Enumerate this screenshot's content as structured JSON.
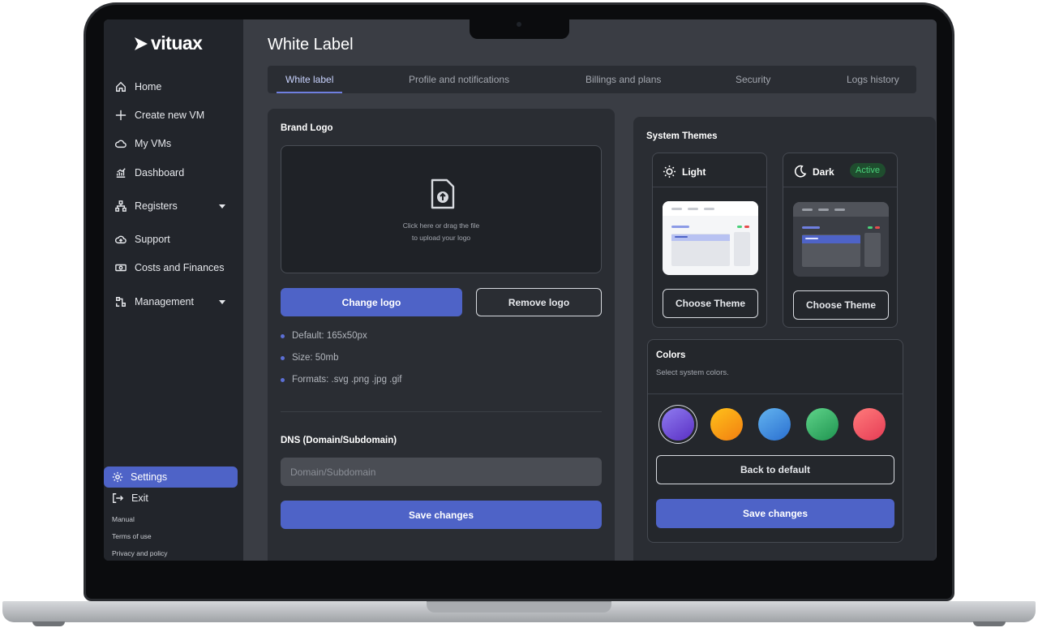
{
  "brand": {
    "name": "vituax"
  },
  "sidebar": {
    "items": [
      {
        "label": "Home",
        "icon": "home-icon"
      },
      {
        "label": "Create new VM",
        "icon": "plus-icon"
      },
      {
        "label": "My VMs",
        "icon": "cloud-icon"
      },
      {
        "label": "Dashboard",
        "icon": "chart-icon"
      },
      {
        "label": "Registers",
        "icon": "hierarchy-icon",
        "dropdown": true
      },
      {
        "label": "Support",
        "icon": "cloud-upload-icon"
      },
      {
        "label": "Costs and Finances",
        "icon": "money-icon"
      },
      {
        "label": "Management",
        "icon": "management-icon",
        "dropdown": true
      }
    ],
    "settings_label": "Settings",
    "exit_label": "Exit",
    "links": [
      "Manual",
      "Terms of use",
      "Privacy and policy"
    ]
  },
  "page": {
    "title": "White Label"
  },
  "tabs": [
    {
      "label": "White label",
      "active": true
    },
    {
      "label": "Profile and notifications",
      "active": false
    },
    {
      "label": "Billings and plans",
      "active": false
    },
    {
      "label": "Security",
      "active": false
    },
    {
      "label": "Logs history",
      "active": false
    }
  ],
  "brand_logo": {
    "title": "Brand Logo",
    "upload_line1": "Click here or drag the file",
    "upload_line2": "to upload your logo",
    "change_label": "Change logo",
    "remove_label": "Remove logo",
    "specs": [
      "Default: 165x50px",
      "Size: 50mb",
      "Formats: .svg .png .jpg .gif"
    ]
  },
  "dns": {
    "title": "DNS (Domain/Subdomain)",
    "placeholder": "Domain/Subdomain",
    "value": "",
    "save_label": "Save changes"
  },
  "themes": {
    "title": "System Themes",
    "light": {
      "label": "Light",
      "button": "Choose Theme"
    },
    "dark": {
      "label": "Dark",
      "badge": "Active",
      "button": "Choose Theme"
    }
  },
  "colors": {
    "title": "Colors",
    "subtitle": "Select system colors.",
    "swatches": [
      {
        "name": "purple",
        "from": "#8f7cf0",
        "to": "#5a2fc4",
        "selected": true
      },
      {
        "name": "orange",
        "from": "#ffc21a",
        "to": "#f27e11",
        "selected": false
      },
      {
        "name": "blue",
        "from": "#63b4f0",
        "to": "#2a6fd0",
        "selected": false
      },
      {
        "name": "green",
        "from": "#5fd48a",
        "to": "#1f9450",
        "selected": false
      },
      {
        "name": "red",
        "from": "#ff7b7b",
        "to": "#e63c55",
        "selected": false
      }
    ],
    "back_label": "Back to default",
    "save_label": "Save changes"
  },
  "accent_color": "#4e63c7"
}
